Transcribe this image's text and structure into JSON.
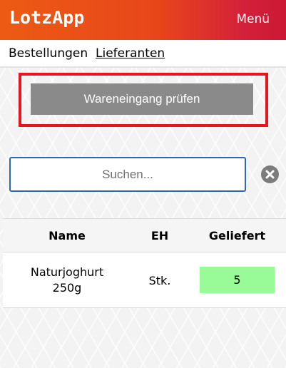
{
  "header": {
    "logo": "LotzApp",
    "menu_label": "Menü"
  },
  "tabs": [
    {
      "label": "Bestellungen"
    },
    {
      "label": "Lieferanten"
    }
  ],
  "check_button_label": "Wareneingang prüfen",
  "search": {
    "placeholder": "Suchen...",
    "value": ""
  },
  "table": {
    "columns": [
      "Name",
      "EH",
      "Geliefert"
    ],
    "rows": [
      {
        "name_line1": "Naturjoghurt",
        "name_line2": "250g",
        "unit": "Stk.",
        "delivered": "5"
      }
    ]
  },
  "colors": {
    "header_start": "#ec5b14",
    "header_end": "#cc1834",
    "highlight_border": "#e8141e",
    "qty_bg": "#98fb98"
  },
  "icons": {
    "clear": "clear-circle-icon"
  }
}
